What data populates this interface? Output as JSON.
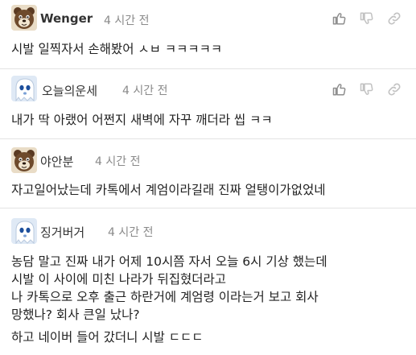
{
  "comments": [
    {
      "author": "Wenger",
      "time": "4 시간 전",
      "lines": [
        "시발 일찍자서 손해봤어 ㅅㅂ ㅋㅋㅋㅋㅋ"
      ],
      "avatar_icon": "bear-avatar-icon"
    },
    {
      "author": "오늘의운세",
      "time": "4 시간 전",
      "lines": [
        "내가 딱 아랬어 어쩐지 새벽에 자꾸 깨더라 씹 ㅋㅋ"
      ],
      "avatar_icon": "ghost-avatar-icon"
    },
    {
      "author": "야안분",
      "time": "4 시간 전",
      "lines": [
        "자고일어났는데 카톡에서 계엄이라길래 진짜 얼탱이가없었네"
      ],
      "avatar_icon": "bear-avatar-icon"
    },
    {
      "author": "징거버거",
      "time": "4 시간 전",
      "lines": [
        "농담 말고 진짜 내가 어제 10시쯤 자서 오늘 6시 기상 했는데",
        "시발 이 사이에 미친 나라가 뒤집혔더라고",
        "나 카톡으로 오후 출근 하란거에 계엄령 이라는거 보고 회사",
        "망했나? 회사 큰일 났나?",
        "하고 네이버 들어 갔더니 시발 ㄷㄷㄷ"
      ],
      "avatar_icon": "ghost-avatar-icon"
    }
  ],
  "icons": {
    "like": "thumbs-up-icon",
    "dislike": "thumbs-down-icon",
    "link": "link-icon"
  },
  "colors": {
    "text": "#222222",
    "meta": "#8a8a8a",
    "icon": "#9a9a9a",
    "divider": "#e3e3e3"
  }
}
